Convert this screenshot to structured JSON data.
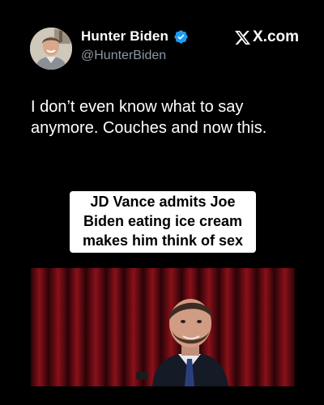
{
  "tweet": {
    "author_name": "Hunter Biden",
    "author_handle": "@HunterBiden",
    "source_label": "X.com",
    "text": "I don’t even know what to say anymore. Couches and now this."
  },
  "media": {
    "headline": "JD Vance admits Joe Biden eating ice cream makes him think of sex"
  },
  "colors": {
    "background": "#000000",
    "verified_badge": "#1d9bf0",
    "handle": "#8b98a5",
    "curtain": "#6e0a12"
  },
  "icons": {
    "verified": "verified-badge-icon",
    "brand": "x-logo-icon"
  }
}
